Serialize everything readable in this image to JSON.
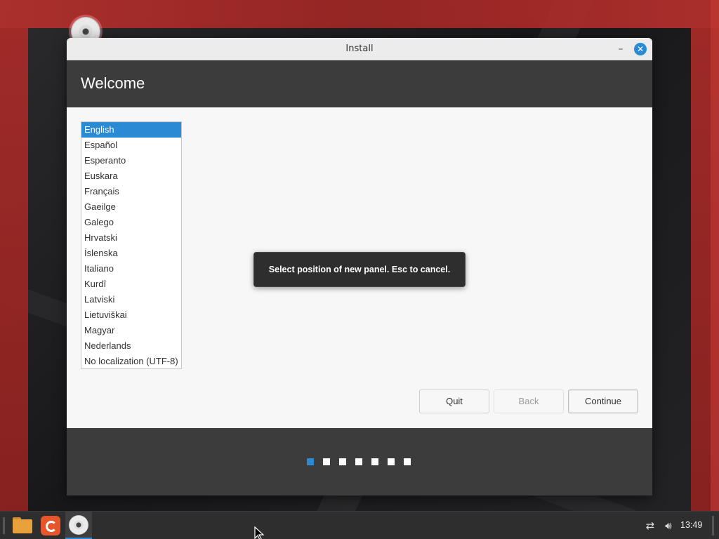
{
  "window": {
    "title": "Install",
    "minimize_glyph": "–",
    "close_glyph": "✕"
  },
  "header": {
    "title": "Welcome"
  },
  "languages": {
    "selected": "English",
    "items": [
      "English",
      "Español",
      "Esperanto",
      "Euskara",
      "Français",
      "Gaeilge",
      "Galego",
      "Hrvatski",
      "Íslenska",
      "Italiano",
      "Kurdî",
      "Latviski",
      "Lietuviškai",
      "Magyar",
      "Nederlands",
      "No localization (UTF-8)"
    ]
  },
  "buttons": {
    "quit": "Quit",
    "back": "Back",
    "continue": "Continue"
  },
  "toast": {
    "text": "Select position of new panel. Esc to cancel."
  },
  "progress": {
    "total_steps": 7,
    "current_step": 1
  },
  "taskbar": {
    "apps": [
      "folder-icon",
      "firefox-icon",
      "installer-disc-icon"
    ],
    "tray": {
      "network_icon": "network-icon",
      "volume_icon": "volume-icon"
    },
    "clock": "13:49"
  },
  "colors": {
    "accent": "#2a8ad4",
    "header_bg": "#3c3c3c",
    "desktop_red": "#b02a29"
  }
}
